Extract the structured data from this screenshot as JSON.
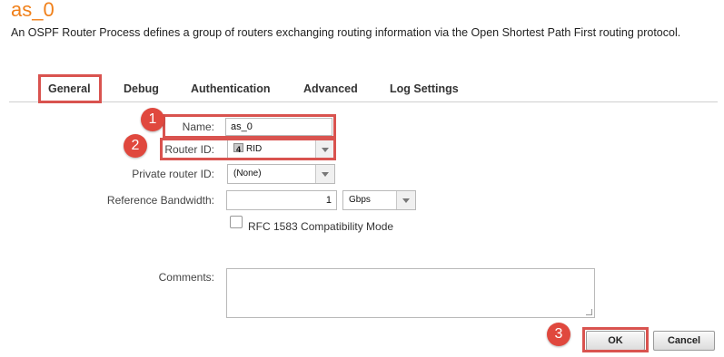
{
  "header": {
    "title": "as_0",
    "description": "An OSPF Router Process defines a group of routers exchanging routing information via the Open Shortest Path First routing protocol."
  },
  "tabs": [
    {
      "label": "General",
      "active": true
    },
    {
      "label": "Debug"
    },
    {
      "label": "Authentication"
    },
    {
      "label": "Advanced"
    },
    {
      "label": "Log Settings"
    }
  ],
  "form": {
    "name": {
      "label": "Name:",
      "value": "as_0"
    },
    "router_id": {
      "label": "Router ID:",
      "icon_number": "4",
      "value": "RID"
    },
    "private_router_id": {
      "label": "Private router ID:",
      "value": "(None)"
    },
    "reference_bandwidth": {
      "label": "Reference Bandwidth:",
      "value": "1",
      "unit": "Gbps"
    },
    "rfc1583": {
      "label": "RFC 1583 Compatibility Mode",
      "checked": false
    },
    "comments": {
      "label": "Comments:",
      "value": ""
    }
  },
  "buttons": {
    "ok": "OK",
    "cancel": "Cancel"
  },
  "annotations": {
    "badge_1": "1",
    "badge_2": "2",
    "badge_3": "3",
    "color": "#e0483e"
  },
  "colors": {
    "title": "#f0801a",
    "highlight": "#d9534f"
  }
}
